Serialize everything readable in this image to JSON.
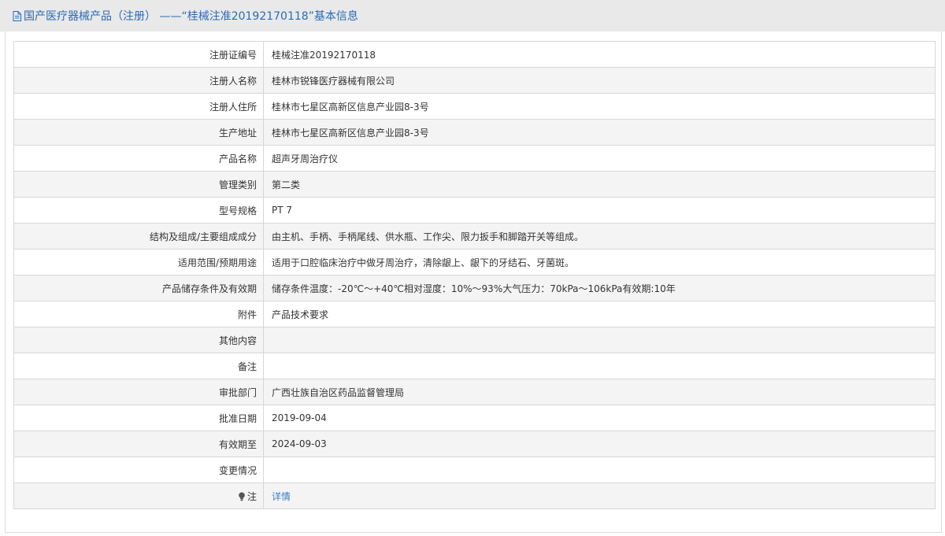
{
  "header": {
    "title": "国产医疗器械产品（注册） ——“桂械注准20192170118”基本信息",
    "icon": "document-icon",
    "title_color": "#2a6bb5"
  },
  "rows": [
    {
      "label": "注册证编号",
      "value": "桂械注准20192170118"
    },
    {
      "label": "注册人名称",
      "value": "桂林市锐锋医疗器械有限公司"
    },
    {
      "label": "注册人住所",
      "value": "桂林市七星区高新区信息产业园8-3号"
    },
    {
      "label": "生产地址",
      "value": "桂林市七星区高新区信息产业园8-3号"
    },
    {
      "label": "产品名称",
      "value": "超声牙周治疗仪"
    },
    {
      "label": "管理类别",
      "value": "第二类"
    },
    {
      "label": "型号规格",
      "value": "PT 7"
    },
    {
      "label": "结构及组成/主要组成成分",
      "value": "由主机、手柄、手柄尾线、供水瓶、工作尖、限力扳手和脚踏开关等组成。"
    },
    {
      "label": "适用范围/预期用途",
      "value": "适用于口腔临床治疗中做牙周治疗，清除龈上、龈下的牙结石、牙菌斑。"
    },
    {
      "label": "产品储存条件及有效期",
      "value": "储存条件温度：-20℃～+40℃相对湿度：10%～93%大气压力：70kPa～106kPa有效期:10年"
    },
    {
      "label": "附件",
      "value": "产品技术要求"
    },
    {
      "label": "其他内容",
      "value": ""
    },
    {
      "label": "备注",
      "value": ""
    },
    {
      "label": "审批部门",
      "value": "广西壮族自治区药品监督管理局"
    },
    {
      "label": "批准日期",
      "value": "2019-09-04"
    },
    {
      "label": "有效期至",
      "value": "2024-09-03"
    },
    {
      "label": "变更情况",
      "value": ""
    }
  ],
  "note_row": {
    "icon": "lightbulb-icon",
    "label": "注",
    "link_text": "详情",
    "link_color": "#3a7ec6"
  }
}
